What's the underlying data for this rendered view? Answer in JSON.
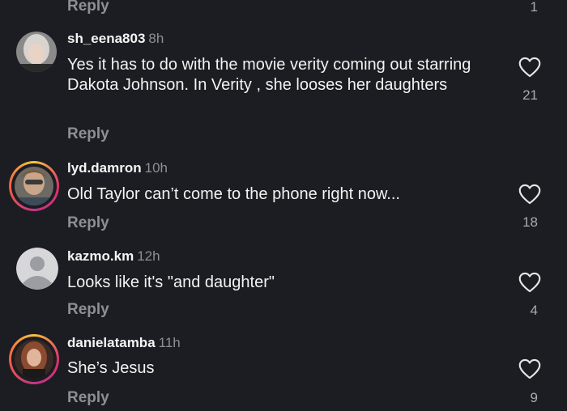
{
  "top": {
    "reply_label": "Reply",
    "like_count": "1"
  },
  "comments": [
    {
      "username": "sh_eena803",
      "time": "8h",
      "text": "Yes it has to do with the movie verity coming out starring Dakota Johnson. In Verity , she looses her daughters",
      "reply_label": "Reply",
      "like_count": "21"
    },
    {
      "username": "lyd.damron",
      "time": "10h",
      "text": "Old Taylor can’t come to the phone right now...",
      "reply_label": "Reply",
      "like_count": "18"
    },
    {
      "username": "kazmo.km",
      "time": "12h",
      "text": "Looks like it's \"and daughter\"",
      "reply_label": "Reply",
      "like_count": "4"
    },
    {
      "username": "danielatamba",
      "time": "11h",
      "text": "She’s Jesus",
      "reply_label": "Reply",
      "like_count": "9"
    }
  ],
  "colors": {
    "background": "#1c1d22",
    "text_primary": "#f2f2f2",
    "text_secondary": "#8e8f94",
    "story_ring": "#e1306c"
  },
  "icons": {
    "like": "heart-outline-icon",
    "default_avatar": "default-avatar-icon"
  }
}
